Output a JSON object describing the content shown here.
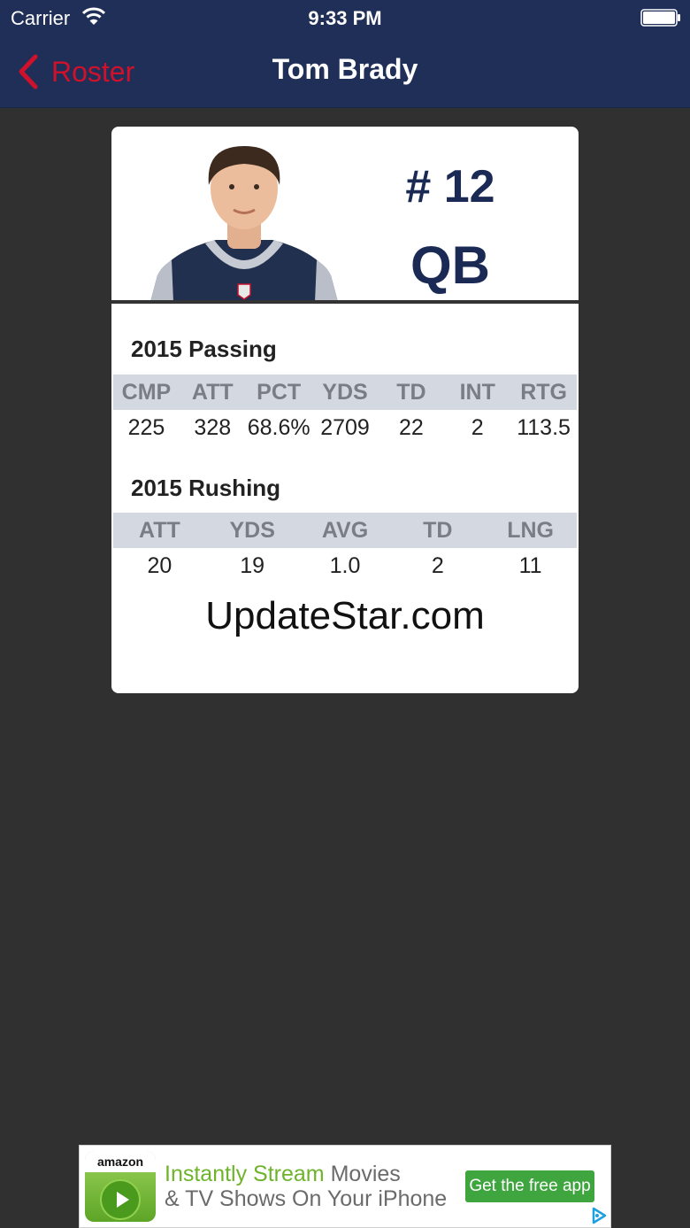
{
  "status_bar": {
    "carrier": "Carrier",
    "time": "9:33 PM"
  },
  "nav": {
    "back_label": "Roster",
    "title": "Tom Brady"
  },
  "player": {
    "number": "# 12",
    "position": "QB"
  },
  "passing": {
    "title": "2015 Passing",
    "headers": [
      "CMP",
      "ATT",
      "PCT",
      "YDS",
      "TD",
      "INT",
      "RTG"
    ],
    "values": [
      "225",
      "328",
      "68.6%",
      "2709",
      "22",
      "2",
      "113.5"
    ]
  },
  "rushing": {
    "title": "2015 Rushing",
    "headers": [
      "ATT",
      "YDS",
      "AVG",
      "TD",
      "LNG"
    ],
    "values": [
      "20",
      "19",
      "1.0",
      "2",
      "11"
    ]
  },
  "watermark": "UpdateStar.com",
  "ad": {
    "brand": "amazon",
    "line1_highlight": "Instantly Stream",
    "line1_rest": " Movies",
    "line2": "& TV Shows On Your iPhone",
    "cta": "Get the free app"
  },
  "colors": {
    "nav_bg": "#1f2f57",
    "accent_red": "#d0112b",
    "team_navy": "#1a2a55"
  }
}
